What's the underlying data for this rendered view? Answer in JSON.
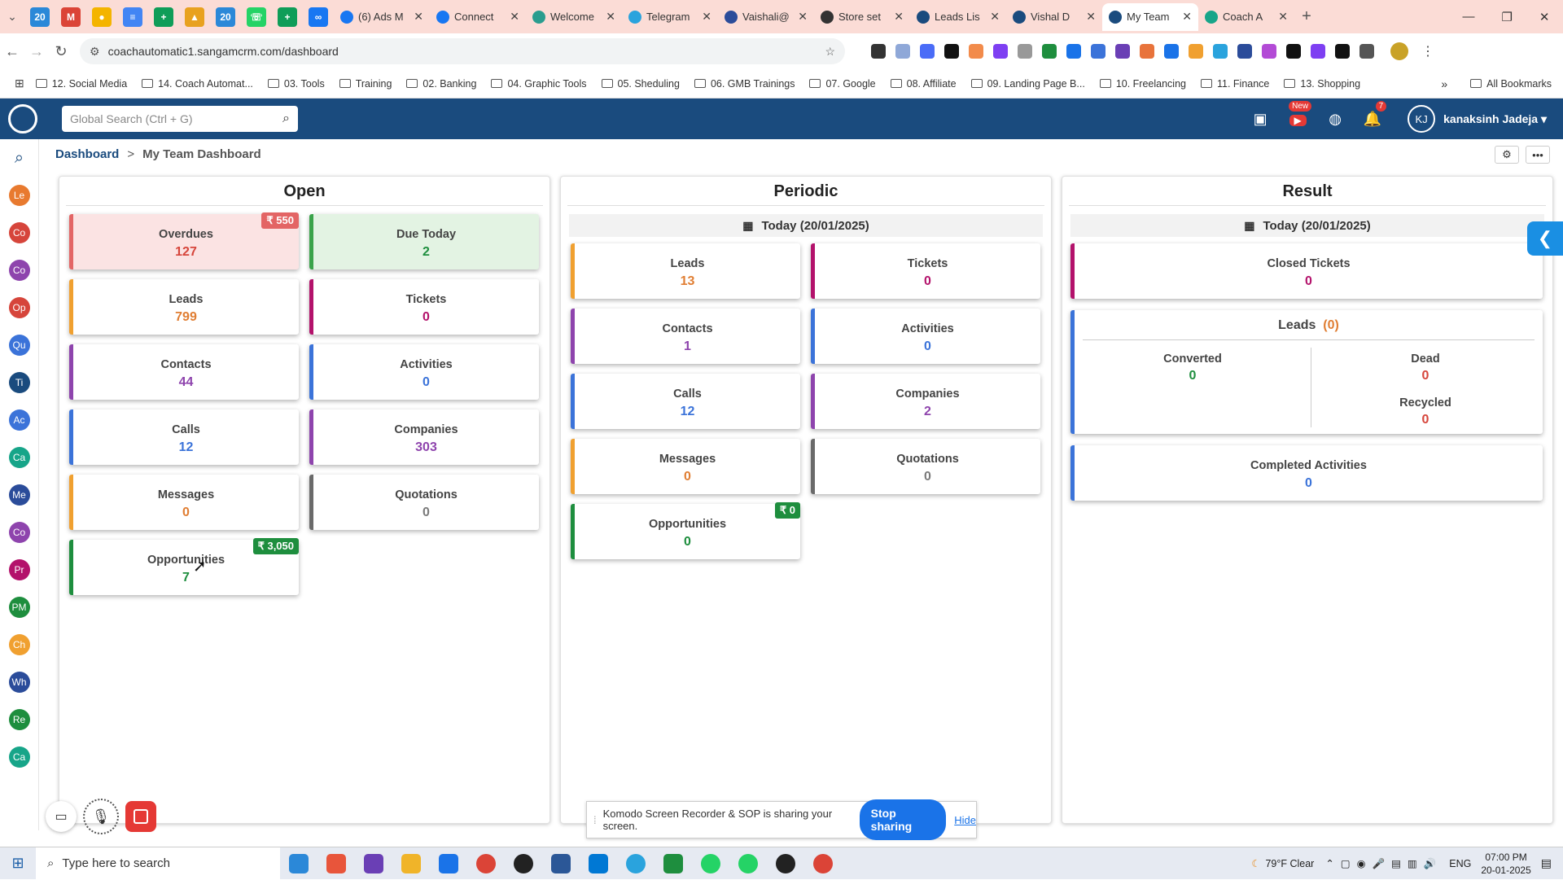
{
  "browser": {
    "pinned_tabs": [
      "20",
      "M",
      "●",
      "≡",
      "+",
      "▲",
      "20",
      "☏",
      "+",
      "∞"
    ],
    "tabs": [
      {
        "label": "(6) Ads M",
        "color": "#1877f2"
      },
      {
        "label": "Connect",
        "color": "#1877f2"
      },
      {
        "label": "Welcome",
        "color": "#2a9d8f"
      },
      {
        "label": "Telegram",
        "color": "#2aa3dd"
      },
      {
        "label": "Vaishali@",
        "color": "#2b4c9a"
      },
      {
        "label": "Store set",
        "color": "#333333"
      },
      {
        "label": "Leads Lis",
        "color": "#1a4b7e"
      },
      {
        "label": "Vishal D",
        "color": "#1a4b7e"
      },
      {
        "label": "My Team",
        "color": "#1a4b7e"
      },
      {
        "label": "Coach A",
        "color": "#17a589"
      }
    ],
    "url": "coachautomatic1.sangamcrm.com/dashboard",
    "bookmarks": [
      "12. Social Media",
      "14. Coach Automat...",
      "03. Tools",
      "Training",
      "02. Banking",
      "04. Graphic Tools",
      "05. Sheduling",
      "06. GMB Trainings",
      "07. Google",
      "08. Affiliate",
      "09. Landing Page B...",
      "10. Freelancing",
      "11. Finance",
      "13. Shopping"
    ],
    "all_bookmarks": "All Bookmarks"
  },
  "app": {
    "search_placeholder": "Global Search (Ctrl + G)",
    "notif_count": "7",
    "new_badge": "New",
    "user_initials": "KJ",
    "user_name": "kanaksinh Jadeja",
    "sidebar": [
      {
        "abbr": "Le",
        "color": "#e87a2f"
      },
      {
        "abbr": "Co",
        "color": "#d6453b"
      },
      {
        "abbr": "Co",
        "color": "#8e44ad"
      },
      {
        "abbr": "Op",
        "color": "#d6453b"
      },
      {
        "abbr": "Qu",
        "color": "#3b73d9"
      },
      {
        "abbr": "Ti",
        "color": "#1a4b7e"
      },
      {
        "abbr": "Ac",
        "color": "#3b73d9"
      },
      {
        "abbr": "Ca",
        "color": "#17a589"
      },
      {
        "abbr": "Me",
        "color": "#2b4c9a"
      },
      {
        "abbr": "Co",
        "color": "#8e44ad"
      },
      {
        "abbr": "Pr",
        "color": "#b3126b"
      },
      {
        "abbr": "PM",
        "color": "#1e8e3e"
      },
      {
        "abbr": "Ch",
        "color": "#f0a030"
      },
      {
        "abbr": "Wh",
        "color": "#2b4c9a"
      },
      {
        "abbr": "Re",
        "color": "#1e8e3e"
      },
      {
        "abbr": "Ca",
        "color": "#17a589"
      }
    ]
  },
  "breadcrumb": {
    "root": "Dashboard",
    "current": "My Team Dashboard"
  },
  "open": {
    "title": "Open",
    "overdues": {
      "label": "Overdues",
      "value": "127",
      "amount": "₹ 550"
    },
    "due_today": {
      "label": "Due Today",
      "value": "2"
    },
    "leads": {
      "label": "Leads",
      "value": "799"
    },
    "tickets": {
      "label": "Tickets",
      "value": "0"
    },
    "contacts": {
      "label": "Contacts",
      "value": "44"
    },
    "activities": {
      "label": "Activities",
      "value": "0"
    },
    "calls": {
      "label": "Calls",
      "value": "12"
    },
    "companies": {
      "label": "Companies",
      "value": "303"
    },
    "messages": {
      "label": "Messages",
      "value": "0"
    },
    "quotations": {
      "label": "Quotations",
      "value": "0"
    },
    "opportunities": {
      "label": "Opportunities",
      "value": "7",
      "amount": "₹ 3,050"
    }
  },
  "periodic": {
    "title": "Periodic",
    "date": "Today (20/01/2025)",
    "leads": {
      "label": "Leads",
      "value": "13"
    },
    "tickets": {
      "label": "Tickets",
      "value": "0"
    },
    "contacts": {
      "label": "Contacts",
      "value": "1"
    },
    "activities": {
      "label": "Activities",
      "value": "0"
    },
    "calls": {
      "label": "Calls",
      "value": "12"
    },
    "companies": {
      "label": "Companies",
      "value": "2"
    },
    "messages": {
      "label": "Messages",
      "value": "0"
    },
    "quotations": {
      "label": "Quotations",
      "value": "0"
    },
    "opportunities": {
      "label": "Opportunities",
      "value": "0",
      "amount": "₹ 0"
    }
  },
  "result": {
    "title": "Result",
    "date": "Today (20/01/2025)",
    "closed_tickets": {
      "label": "Closed Tickets",
      "value": "0"
    },
    "leads": {
      "label": "Leads",
      "count": "(0)",
      "converted_label": "Converted",
      "converted": "0",
      "dead_label": "Dead",
      "dead": "0",
      "recycled_label": "Recycled",
      "recycled": "0"
    },
    "completed_activities": {
      "label": "Completed Activities",
      "value": "0"
    }
  },
  "share": {
    "text": "Komodo Screen Recorder & SOP is sharing your screen.",
    "stop": "Stop sharing",
    "hide": "Hide"
  },
  "taskbar": {
    "search": "Type here to search",
    "weather": "79°F  Clear",
    "lang": "ENG",
    "time": "07:00 PM",
    "date": "20-01-2025",
    "apps": [
      "#2b88d8",
      "#e8553b",
      "#6a3fb5",
      "#f0b429",
      "#1a73e8",
      "#db4437",
      "#222222",
      "#2b5797",
      "#0078d4",
      "#2aa3dd",
      "#1e8e3e",
      "#25d366",
      "#25d366",
      "#222222",
      "#db4437"
    ]
  }
}
